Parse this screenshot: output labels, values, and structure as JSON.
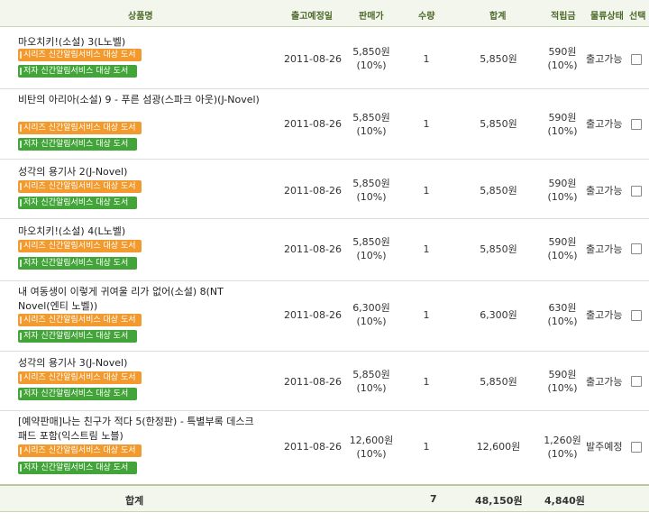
{
  "header": {
    "product": "상품명",
    "ship_date": "출고예정일",
    "price": "판매가",
    "qty": "수량",
    "total": "합계",
    "points": "적립금",
    "status": "물류상태",
    "select": "선택"
  },
  "badges": {
    "series": "시리즈 신간알림서비스 대상 도서",
    "author": "저자 신간알림서비스 대상 도서"
  },
  "items": [
    {
      "title": "마오치키!(소설) 3(L노벨)",
      "date": "2011-08-26",
      "price": "5,850원",
      "discount": "(10%)",
      "qty": "1",
      "total": "5,850원",
      "points": "590원",
      "points_rate": "(10%)",
      "status": "출고가능"
    },
    {
      "title": "비탄의 아리아(소설) 9 - 푸른 섬광(스파크 아웃)(J-Novel)",
      "date": "2011-08-26",
      "price": "5,850원",
      "discount": "(10%)",
      "qty": "1",
      "total": "5,850원",
      "points": "590원",
      "points_rate": "(10%)",
      "status": "출고가능"
    },
    {
      "title": "성각의 용기사 2(J-Novel)",
      "date": "2011-08-26",
      "price": "5,850원",
      "discount": "(10%)",
      "qty": "1",
      "total": "5,850원",
      "points": "590원",
      "points_rate": "(10%)",
      "status": "출고가능"
    },
    {
      "title": "마오치키!(소설) 4(L노벨)",
      "date": "2011-08-26",
      "price": "5,850원",
      "discount": "(10%)",
      "qty": "1",
      "total": "5,850원",
      "points": "590원",
      "points_rate": "(10%)",
      "status": "출고가능"
    },
    {
      "title": "내 여동생이 이렇게 귀여울 리가 없어(소설) 8(NT Novel(엔티 노벨))",
      "date": "2011-08-26",
      "price": "6,300원",
      "discount": "(10%)",
      "qty": "1",
      "total": "6,300원",
      "points": "630원",
      "points_rate": "(10%)",
      "status": "출고가능"
    },
    {
      "title": "성각의 용기사 3(J-Novel)",
      "date": "2011-08-26",
      "price": "5,850원",
      "discount": "(10%)",
      "qty": "1",
      "total": "5,850원",
      "points": "590원",
      "points_rate": "(10%)",
      "status": "출고가능"
    },
    {
      "title": "[예약판매]나는 친구가 적다 5(한정판) - 특별부록 데스크 패드 포함(익스트림 노블)",
      "date": "2011-08-26",
      "price": "12,600원",
      "discount": "(10%)",
      "qty": "1",
      "total": "12,600원",
      "points": "1,260원",
      "points_rate": "(10%)",
      "status": "발주예정"
    }
  ],
  "summary": {
    "label": "합계",
    "qty": "7",
    "total": "48,150원",
    "points": "4,840원"
  },
  "colors": {
    "header_bg": "#f3f6ec",
    "header_text": "#4d6a2a",
    "series_badge": "#f29a2e",
    "author_badge": "#43a43a"
  }
}
